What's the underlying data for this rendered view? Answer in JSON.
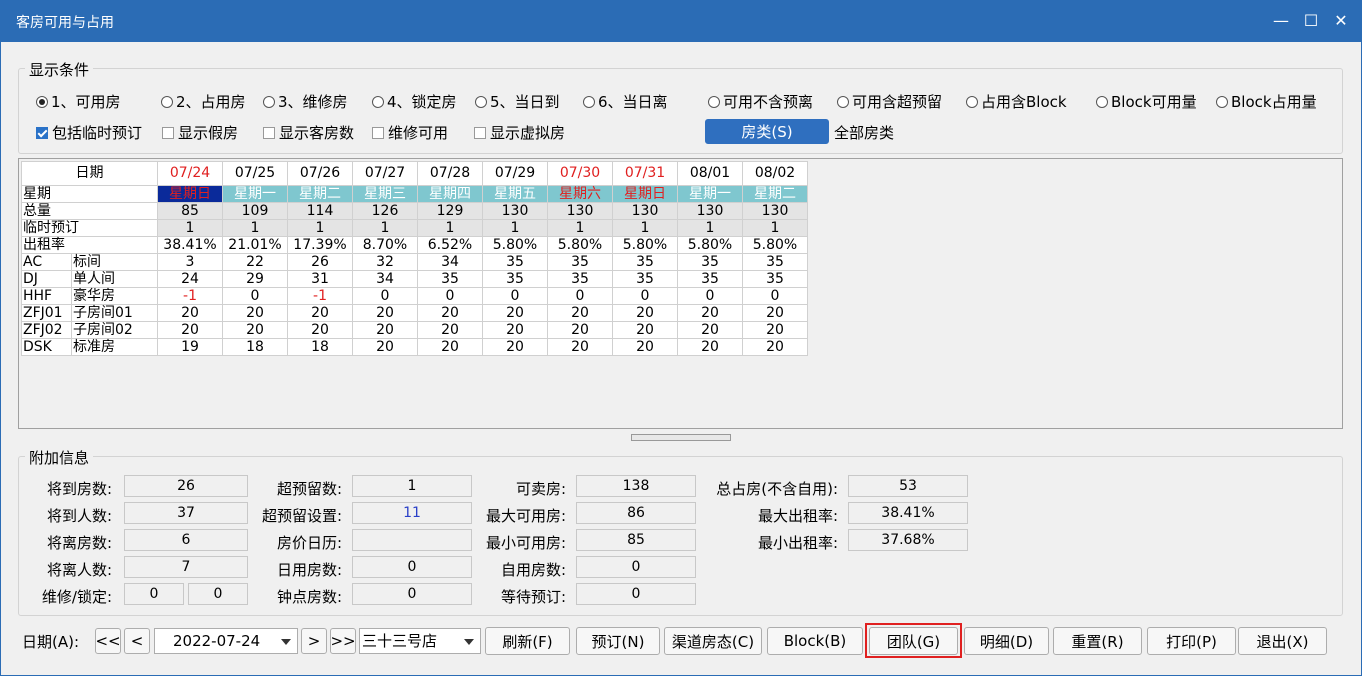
{
  "window": {
    "title": "客房可用与占用",
    "minimize": "—",
    "maximize": "☐",
    "close": "✕"
  },
  "conditions": {
    "title": "显示条件",
    "radios": [
      {
        "label": "1、可用房",
        "checked": true
      },
      {
        "label": "2、占用房",
        "checked": false
      },
      {
        "label": "3、维修房",
        "checked": false
      },
      {
        "label": "4、锁定房",
        "checked": false
      },
      {
        "label": "5、当日到",
        "checked": false
      },
      {
        "label": "6、当日离",
        "checked": false
      }
    ],
    "radios2": [
      {
        "label": "可用不含预离",
        "checked": false
      },
      {
        "label": "可用含超预留",
        "checked": false
      },
      {
        "label": "占用含Block",
        "checked": false
      },
      {
        "label": "Block可用量",
        "checked": false
      },
      {
        "label": "Block占用量",
        "checked": false
      }
    ],
    "checks": [
      {
        "label": "包括临时预订",
        "checked": true
      },
      {
        "label": "显示假房",
        "checked": false
      },
      {
        "label": "显示客房数",
        "checked": false
      },
      {
        "label": "维修可用",
        "checked": false
      },
      {
        "label": "显示虚拟房",
        "checked": false
      }
    ],
    "room_type_button": "房类(S)",
    "room_type_value": "全部房类"
  },
  "grid": {
    "header_label": "日期",
    "dates": [
      "07/24",
      "07/25",
      "07/26",
      "07/27",
      "07/28",
      "07/29",
      "07/30",
      "07/31",
      "08/01",
      "08/02"
    ],
    "red_dates": [
      0,
      6,
      7
    ],
    "rows": [
      {
        "code": "星期",
        "name": "",
        "values": [
          "星期日",
          "星期一",
          "星期二",
          "星期三",
          "星期四",
          "星期五",
          "星期六",
          "星期日",
          "星期一",
          "星期二"
        ],
        "kind": "week"
      },
      {
        "code": "总量",
        "name": "",
        "values": [
          "85",
          "109",
          "114",
          "126",
          "129",
          "130",
          "130",
          "130",
          "130",
          "130"
        ],
        "kind": "gray"
      },
      {
        "code": "临时预订",
        "name": "",
        "values": [
          "1",
          "1",
          "1",
          "1",
          "1",
          "1",
          "1",
          "1",
          "1",
          "1"
        ],
        "kind": "gray"
      },
      {
        "code": "出租率",
        "name": "",
        "values": [
          "38.41%",
          "21.01%",
          "17.39%",
          "8.70%",
          "6.52%",
          "5.80%",
          "5.80%",
          "5.80%",
          "5.80%",
          "5.80%"
        ],
        "kind": "plain"
      },
      {
        "code": "AC",
        "name": "标间",
        "values": [
          "3",
          "22",
          "26",
          "32",
          "34",
          "35",
          "35",
          "35",
          "35",
          "35"
        ],
        "kind": "plain"
      },
      {
        "code": "DJ",
        "name": "单人间",
        "values": [
          "24",
          "29",
          "31",
          "34",
          "35",
          "35",
          "35",
          "35",
          "35",
          "35"
        ],
        "kind": "plain"
      },
      {
        "code": "HHF",
        "name": "豪华房",
        "values": [
          "-1",
          "0",
          "-1",
          "0",
          "0",
          "0",
          "0",
          "0",
          "0",
          "0"
        ],
        "kind": "plain"
      },
      {
        "code": "ZFJ01",
        "name": "子房间01",
        "values": [
          "20",
          "20",
          "20",
          "20",
          "20",
          "20",
          "20",
          "20",
          "20",
          "20"
        ],
        "kind": "plain"
      },
      {
        "code": "ZFJ02",
        "name": "子房间02",
        "values": [
          "20",
          "20",
          "20",
          "20",
          "20",
          "20",
          "20",
          "20",
          "20",
          "20"
        ],
        "kind": "plain"
      },
      {
        "code": "DSK",
        "name": "标准房",
        "values": [
          "19",
          "18",
          "18",
          "20",
          "20",
          "20",
          "20",
          "20",
          "20",
          "20"
        ],
        "kind": "plain"
      }
    ]
  },
  "extra": {
    "title": "附加信息",
    "arrive_rooms_label": "将到房数:",
    "arrive_rooms": "26",
    "arrive_people_label": "将到人数:",
    "arrive_people": "37",
    "depart_rooms_label": "将离房数:",
    "depart_rooms": "6",
    "depart_people_label": "将离人数:",
    "depart_people": "7",
    "repair_lock_label": "维修/锁定:",
    "repair": "0",
    "lock": "0",
    "overbook_label": "超预留数:",
    "overbook": "1",
    "overbook_setting_label": "超预留设置:",
    "overbook_setting": "11",
    "rate_calendar_label": "房价日历:",
    "rate_calendar": "",
    "day_use_label": "日用房数:",
    "day_use": "0",
    "hourly_label": "钟点房数:",
    "hourly": "0",
    "sellable_label": "可卖房:",
    "sellable": "138",
    "max_avail_label": "最大可用房:",
    "max_avail": "86",
    "min_avail_label": "最小可用房:",
    "min_avail": "85",
    "self_use_label": "自用房数:",
    "self_use": "0",
    "waitlist_label": "等待预订:",
    "waitlist": "0",
    "total_occ_label": "总占房(不含自用):",
    "total_occ": "53",
    "max_rate_label": "最大出租率:",
    "max_rate": "38.41%",
    "min_rate_label": "最小出租率:",
    "min_rate": "37.68%"
  },
  "footer": {
    "date_label": "日期(A):",
    "first": "<<",
    "prev": "<",
    "date": "2022-07-24",
    "next": ">",
    "last": ">>",
    "hotel": "三十三号店",
    "refresh": "刷新(F)",
    "reserve": "预订(N)",
    "channel": "渠道房态(C)",
    "block": "Block(B)",
    "group": "团队(G)",
    "detail": "明细(D)",
    "reset": "重置(R)",
    "print": "打印(P)",
    "exit": "退出(X)"
  }
}
